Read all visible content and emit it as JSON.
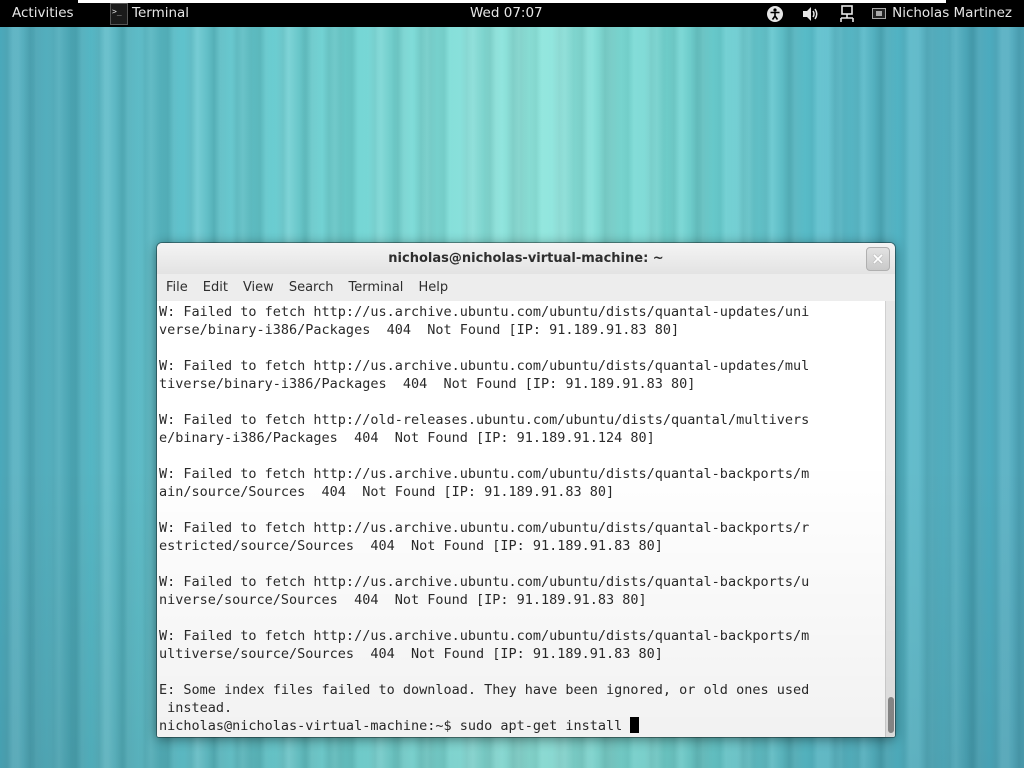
{
  "top_panel": {
    "activities": "Activities",
    "app_name": "Terminal",
    "clock": "Wed 07:07",
    "user": "Nicholas Martinez",
    "icons": [
      "accessibility-icon",
      "volume-icon",
      "network-icon",
      "user-status-icon"
    ]
  },
  "window": {
    "title": "nicholas@nicholas-virtual-machine: ~",
    "close_glyph": "×"
  },
  "menubar": [
    "File",
    "Edit",
    "View",
    "Search",
    "Terminal",
    "Help"
  ],
  "terminal": {
    "lines": [
      "W: Failed to fetch http://us.archive.ubuntu.com/ubuntu/dists/quantal-updates/uni",
      "verse/binary-i386/Packages  404  Not Found [IP: 91.189.91.83 80]",
      "",
      "W: Failed to fetch http://us.archive.ubuntu.com/ubuntu/dists/quantal-updates/mul",
      "tiverse/binary-i386/Packages  404  Not Found [IP: 91.189.91.83 80]",
      "",
      "W: Failed to fetch http://old-releases.ubuntu.com/ubuntu/dists/quantal/multivers",
      "e/binary-i386/Packages  404  Not Found [IP: 91.189.91.124 80]",
      "",
      "W: Failed to fetch http://us.archive.ubuntu.com/ubuntu/dists/quantal-backports/m",
      "ain/source/Sources  404  Not Found [IP: 91.189.91.83 80]",
      "",
      "W: Failed to fetch http://us.archive.ubuntu.com/ubuntu/dists/quantal-backports/r",
      "estricted/source/Sources  404  Not Found [IP: 91.189.91.83 80]",
      "",
      "W: Failed to fetch http://us.archive.ubuntu.com/ubuntu/dists/quantal-backports/u",
      "niverse/source/Sources  404  Not Found [IP: 91.189.91.83 80]",
      "",
      "W: Failed to fetch http://us.archive.ubuntu.com/ubuntu/dists/quantal-backports/m",
      "ultiverse/source/Sources  404  Not Found [IP: 91.189.91.83 80]",
      "",
      "E: Some index files failed to download. They have been ignored, or old ones used",
      " instead."
    ],
    "prompt": "nicholas@nicholas-virtual-machine:~$ ",
    "command": "sudo apt-get install "
  }
}
